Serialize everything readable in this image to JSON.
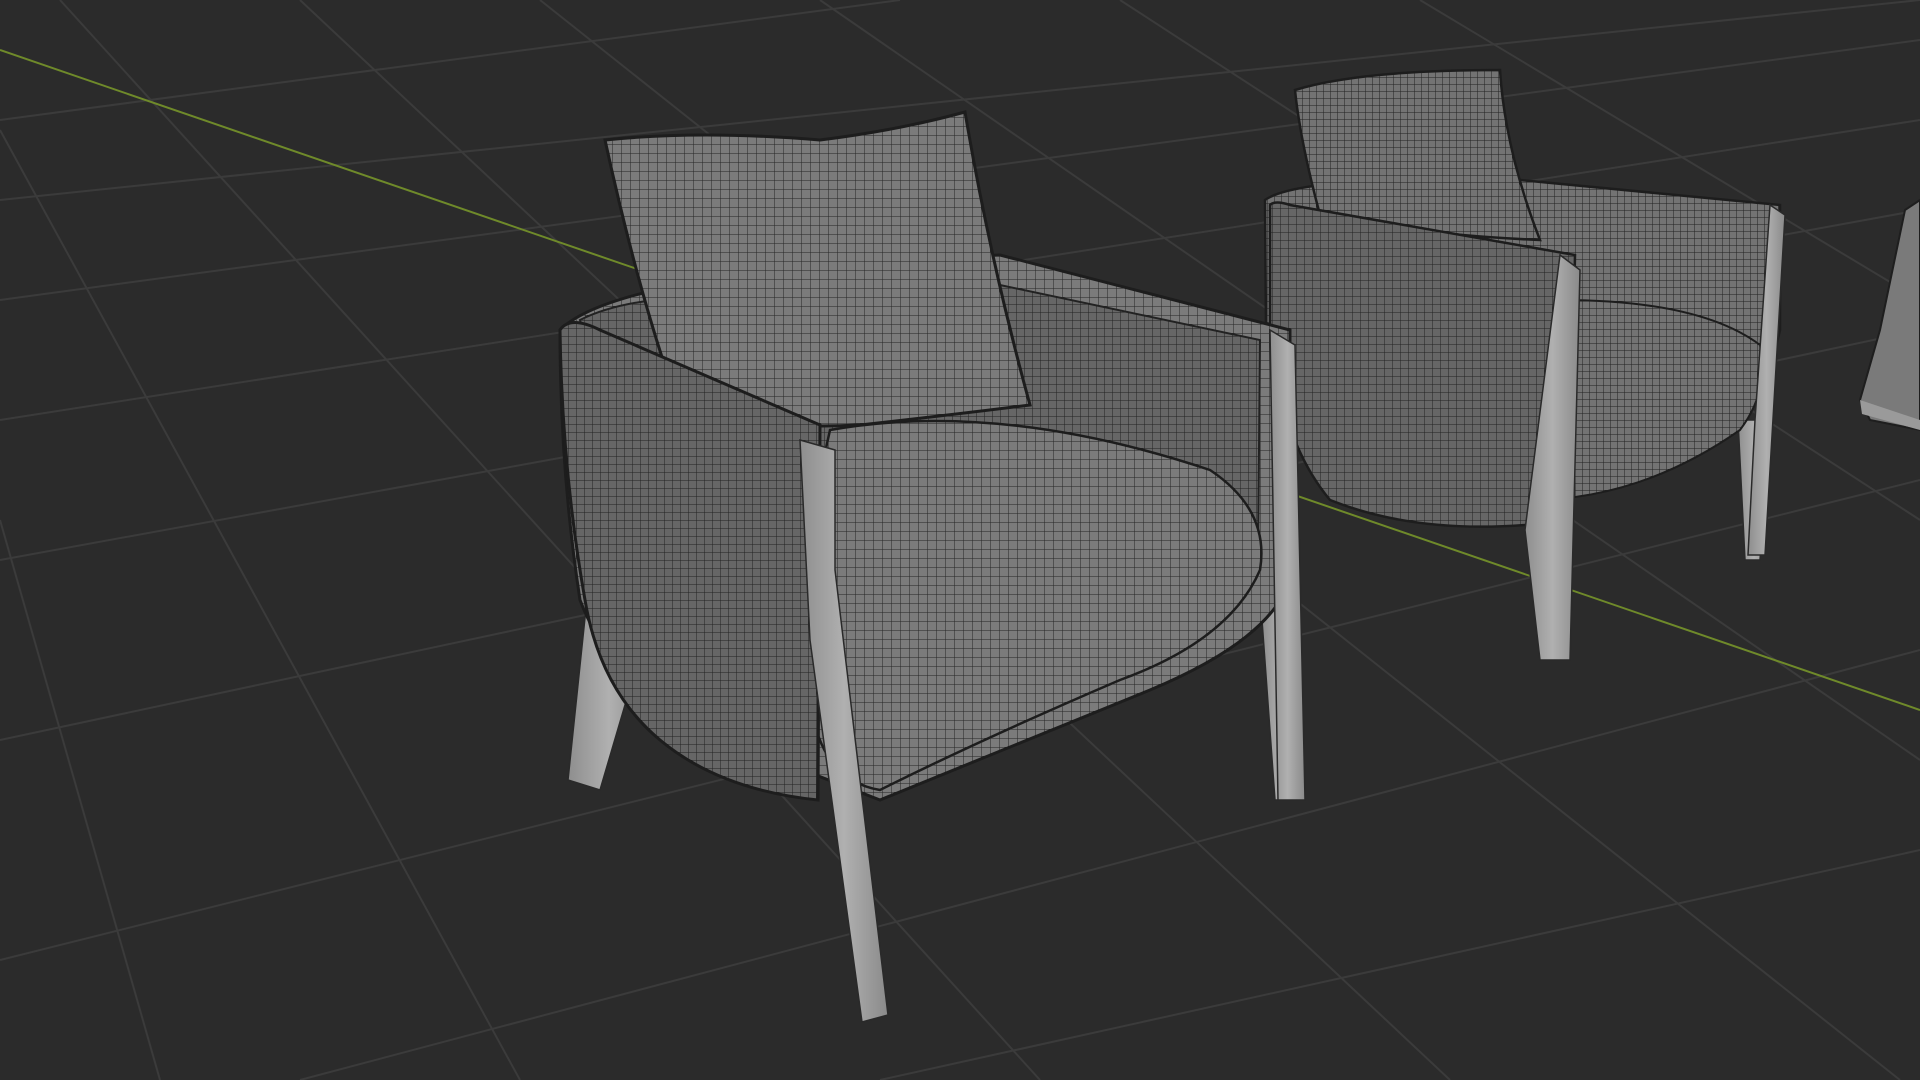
{
  "viewport": {
    "mode": "3d-viewport",
    "shading": "wireframe-overlay",
    "objects": [
      {
        "name": "armchair",
        "role": "foreground"
      },
      {
        "name": "armchair",
        "role": "background"
      },
      {
        "name": "armchair",
        "role": "partially-visible"
      }
    ],
    "icons": {
      "x_axis": "x-axis-line",
      "grid": "floor-grid"
    }
  },
  "colors": {
    "background": "#2b2b2b",
    "grid_line": "#3d3d3d",
    "x_axis": "#6f8a2a",
    "upholstery": "#7b7b7b",
    "upholstery_dark": "#5e5e5e",
    "wood_leg": "#9a9a9a",
    "wire": "#202020"
  }
}
